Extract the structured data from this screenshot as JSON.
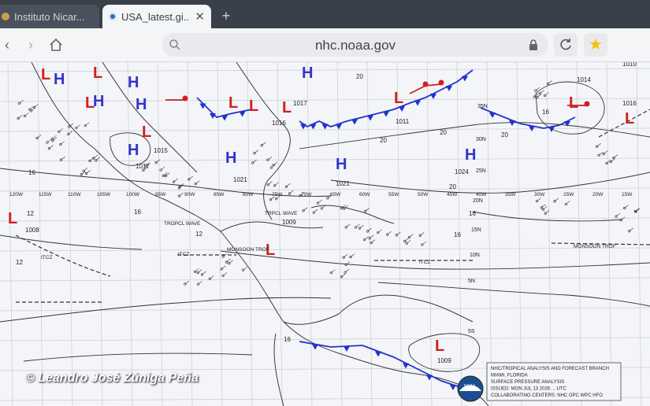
{
  "tabs": [
    {
      "title": "Instituto Nicar...",
      "favicon": "globe-icon"
    },
    {
      "title": "USA_latest.gi...",
      "favicon": "noaa-icon",
      "active": true
    }
  ],
  "new_tab_label": "+",
  "address_bar": {
    "url": "nhc.noaa.gov"
  },
  "watermark": "© Leandro José Zúniga Peña",
  "map": {
    "lows": [
      "L",
      "L",
      "L",
      "L",
      "L",
      "L",
      "L",
      "L",
      "L",
      "L",
      "L",
      "L",
      "L"
    ],
    "highs": [
      "H",
      "H",
      "H",
      "H",
      "H",
      "H",
      "H",
      "H",
      "H"
    ],
    "pressure_labels": [
      "1010",
      "1014",
      "1016",
      "1011",
      "1017",
      "1016",
      "1015",
      "1017",
      "1021",
      "1024",
      "1021",
      "1009",
      "1008",
      "1009"
    ],
    "isobar_labels": [
      "20",
      "20",
      "20",
      "20",
      "20",
      "16",
      "16",
      "16",
      "12",
      "12",
      "12",
      "16",
      "16",
      "16"
    ],
    "lat_labels": [
      "35N",
      "30N",
      "25N",
      "20N",
      "15N",
      "10N",
      "5N",
      "5S"
    ],
    "lon_labels": [
      "120W",
      "115W",
      "110W",
      "105W",
      "100W",
      "95W",
      "90W",
      "85W",
      "80W",
      "75W",
      "70W",
      "65W",
      "60W",
      "55W",
      "50W",
      "45W",
      "40W",
      "35W",
      "30W",
      "25W",
      "20W",
      "15W"
    ],
    "feature_labels": [
      "TROPCL WAVE",
      "TRPCL WAVE",
      "MONSOON TROF",
      "ITCZ",
      "ITCZ",
      "ITCZ",
      "MONSOON TROF"
    ],
    "legend_lines": [
      "NHC/TROPICAL ANALYSIS AND FORECAST BRANCH",
      "MIAMI, FLORIDA",
      "SURFACE PRESSURE ANALYSIS",
      "ISSUED: MON JUL 13 2026 ... UTC",
      "COLLABORATING CENTERS: NHC OPC WPC HFO"
    ],
    "colors": {
      "low": "#d21f1f",
      "high": "#3333cc",
      "cold_front": "#2233cc",
      "warm_front": "#cc2222"
    }
  }
}
